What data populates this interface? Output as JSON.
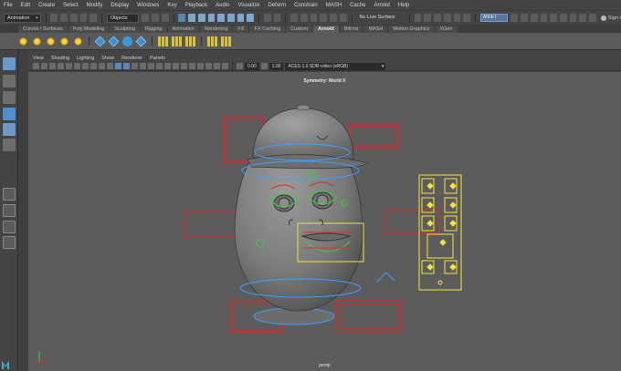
{
  "menubar": {
    "items": [
      "File",
      "Edit",
      "Create",
      "Select",
      "Modify",
      "Display",
      "Windows",
      "Key",
      "Playback",
      "Audio",
      "Visualize",
      "Deform",
      "Constrain",
      "MASH",
      "Cache",
      "Arnold",
      "Help"
    ]
  },
  "statusline": {
    "workspace_menu": "Animation",
    "selection_mode": "Objects",
    "live_surface": "No Live Surface",
    "search_placeholder": "Attrib t",
    "sign_in": "Sign I"
  },
  "shelf": {
    "tabs": [
      "Curves / Surfaces",
      "Poly Modeling",
      "Sculpting",
      "Rigging",
      "Animation",
      "Rendering",
      "FX",
      "FX Caching",
      "Custom",
      "Arnold",
      "Bifrost",
      "MASH",
      "Motion Graphics",
      "XGen"
    ],
    "active_tab": "Arnold"
  },
  "viewport": {
    "menu": [
      "View",
      "Shading",
      "Lighting",
      "Show",
      "Renderer",
      "Panels"
    ],
    "exposure": "0.00",
    "gamma": "1.00",
    "color_space": "ACES 1.0 SDR-video (sRGB)",
    "symmetry_label": "Symmetry: World X",
    "camera": "persp"
  },
  "colors": {
    "rig_red": "#e02828",
    "rig_blue": "#3aa0ff",
    "rig_green": "#38d138",
    "rig_yellow": "#f3e43a",
    "accent": "#5a86b0"
  }
}
